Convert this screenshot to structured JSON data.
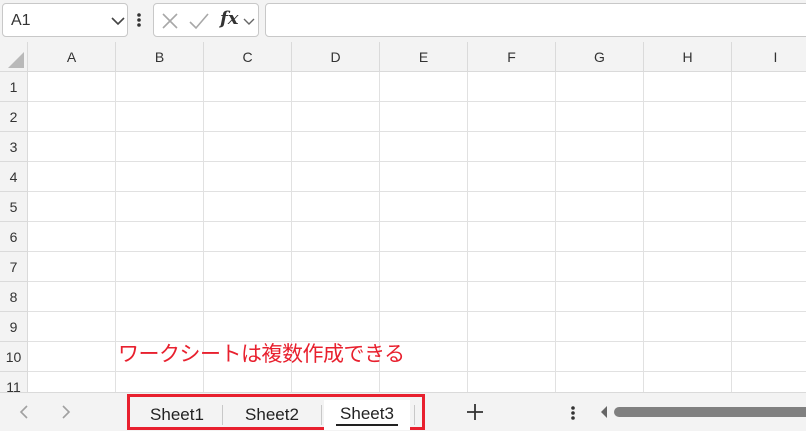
{
  "formula_bar": {
    "name_box_value": "A1",
    "insert_function_label": "fx",
    "formula_value": ""
  },
  "grid": {
    "columns": [
      "A",
      "B",
      "C",
      "D",
      "E",
      "F",
      "G",
      "H",
      "I"
    ],
    "rows": [
      "1",
      "2",
      "3",
      "4",
      "5",
      "6",
      "7",
      "8",
      "9",
      "10",
      "11"
    ]
  },
  "annotation": {
    "text": "ワークシートは複数作成できる",
    "color": "#e8202e"
  },
  "sheet_tabs": {
    "tabs": [
      "Sheet1",
      "Sheet2",
      "Sheet3"
    ],
    "active_index": 2,
    "add_label": "+"
  },
  "icons": {
    "name_box_dropdown": "chevron-down-icon",
    "formula_bar_more": "vertical-ellipsis-icon",
    "cancel": "x-icon",
    "enter": "check-icon",
    "prev_sheet": "chevron-left-icon",
    "next_sheet": "chevron-right-icon",
    "add_sheet": "plus-icon",
    "tab_bar_more": "vertical-ellipsis-icon",
    "scroll_left": "triangle-left-icon"
  },
  "colors": {
    "highlight": "#e8202e",
    "header_bg": "#f3f3f3",
    "gridline": "#e1e1e1"
  }
}
